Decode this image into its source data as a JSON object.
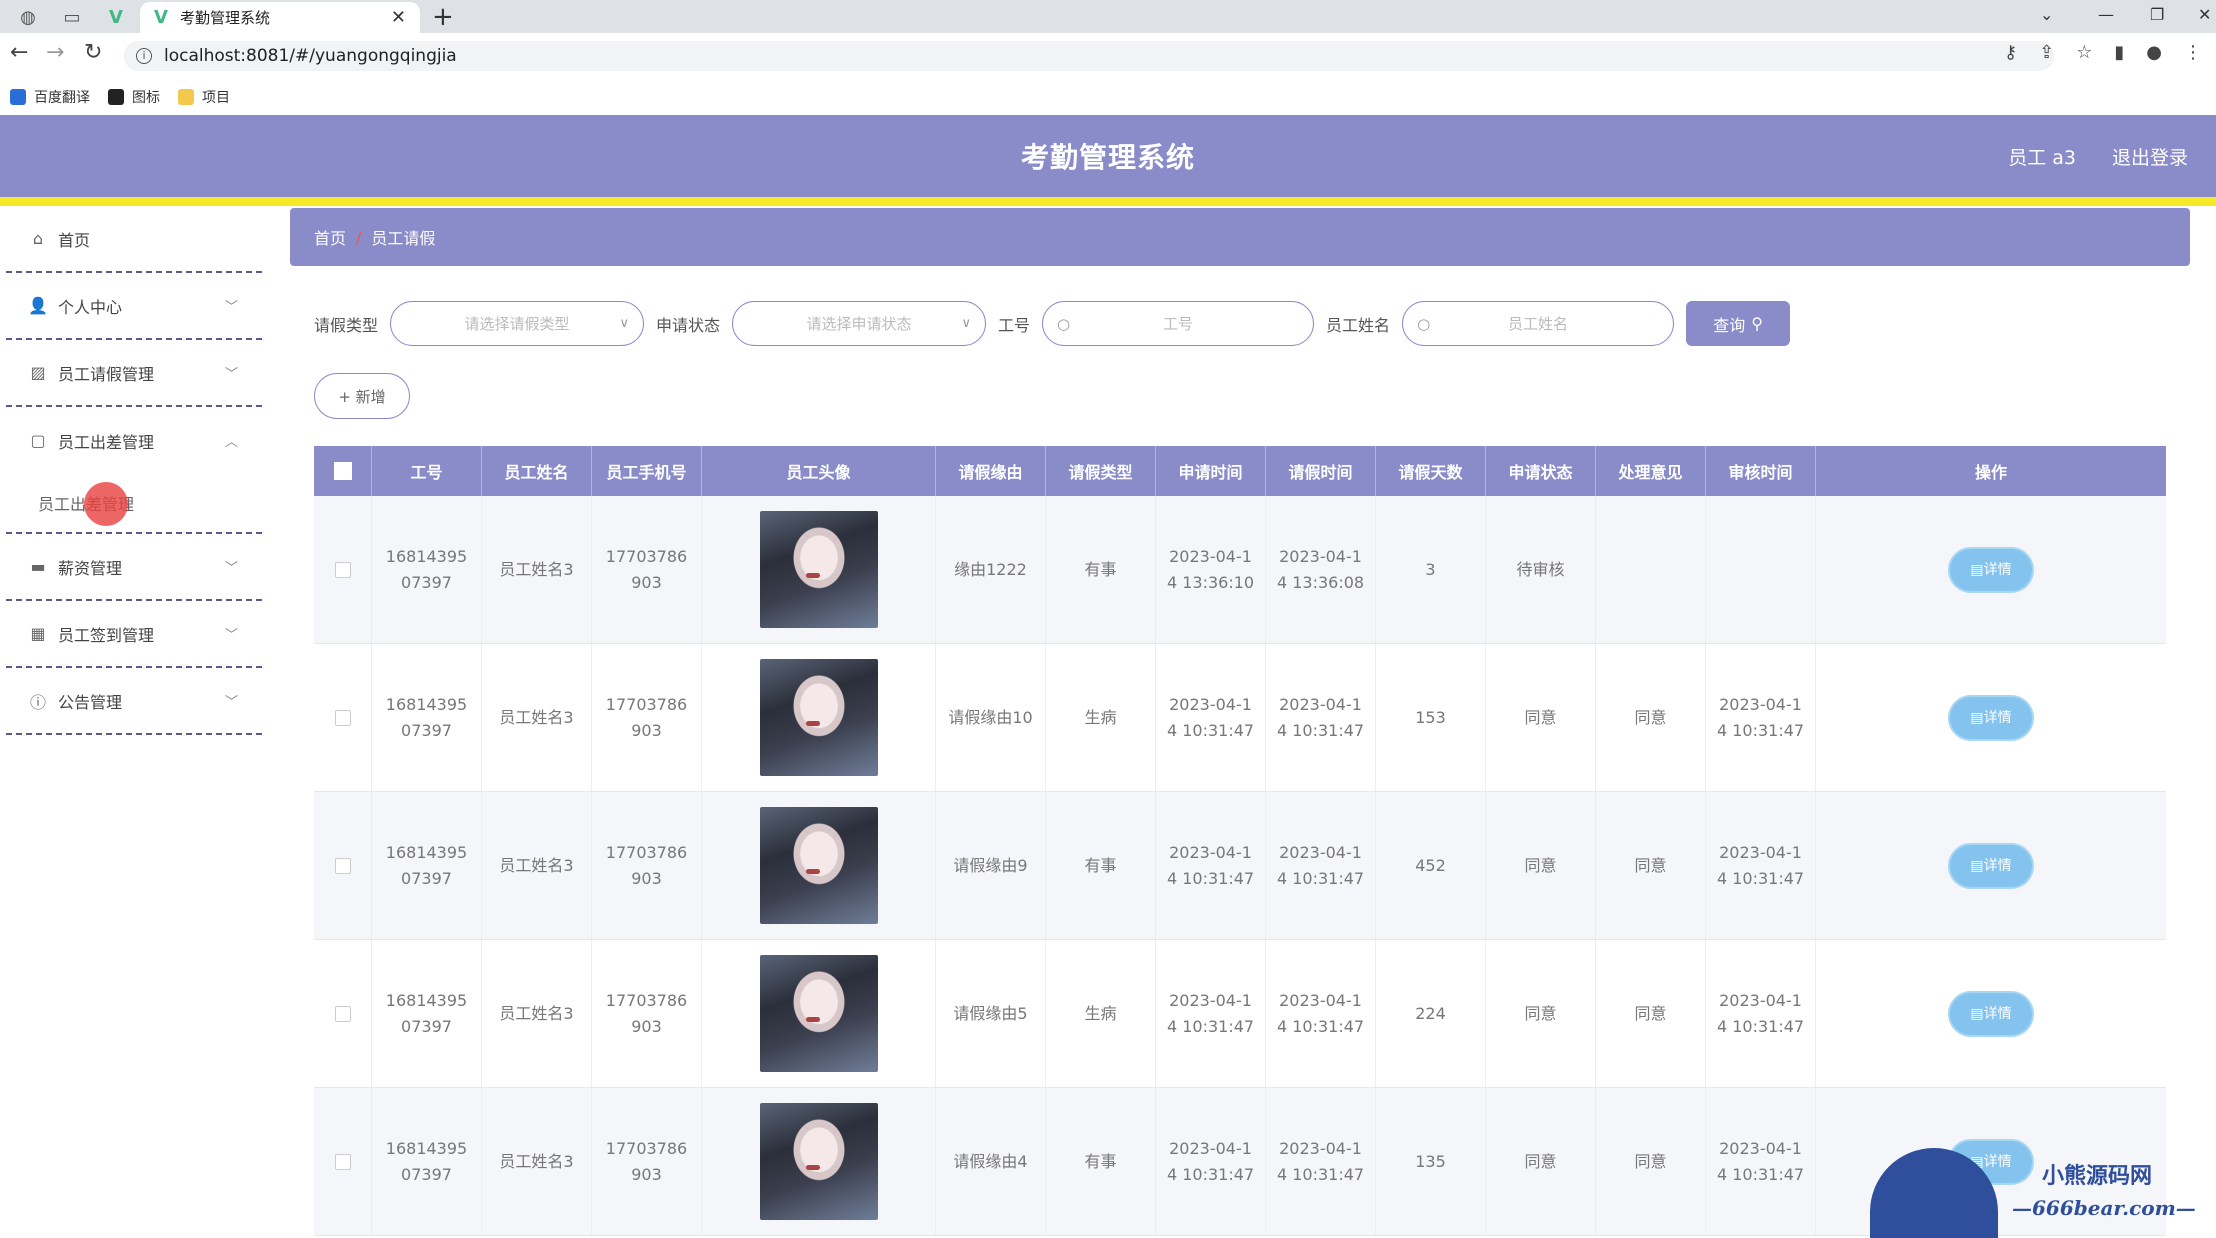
{
  "browser": {
    "tab_title": "考勤管理系统",
    "url": "localhost:8081/#/yuangongqingjia",
    "bookmarks": [
      "百度翻译",
      "图标",
      "项目"
    ]
  },
  "header": {
    "title": "考勤管理系统",
    "user": "员工 a3",
    "logout": "退出登录",
    "bg_color": "#8a8bc9",
    "accent_color": "#f4ea2a"
  },
  "sidebar": {
    "items": [
      {
        "label": "首页",
        "icon": "home-icon"
      },
      {
        "label": "个人中心",
        "icon": "user-icon"
      },
      {
        "label": "员工请假管理",
        "icon": "chart-icon"
      },
      {
        "label": "员工出差管理",
        "icon": "message-icon"
      },
      {
        "label": "薪资管理",
        "icon": "monitor-icon"
      },
      {
        "label": "员工签到管理",
        "icon": "grid-icon"
      },
      {
        "label": "公告管理",
        "icon": "info-icon"
      }
    ],
    "submenu_label": "员工出差管理"
  },
  "breadcrumb": {
    "home": "首页",
    "sep": "/",
    "current": "员工请假"
  },
  "search": {
    "leave_type_label": "请假类型",
    "leave_type_placeholder": "请选择请假类型",
    "status_label": "申请状态",
    "status_placeholder": "请选择申请状态",
    "id_label": "工号",
    "id_placeholder": "工号",
    "name_label": "员工姓名",
    "name_placeholder": "员工姓名",
    "query_button": "查询",
    "add_button": "+ 新增"
  },
  "table": {
    "headers": [
      "工号",
      "员工姓名",
      "员工手机号",
      "员工头像",
      "请假缘由",
      "请假类型",
      "申请时间",
      "请假时间",
      "请假天数",
      "申请状态",
      "处理意见",
      "审核时间",
      "操作"
    ],
    "detail_label": "详情",
    "rows": [
      {
        "id": [
          "16814395",
          "07397"
        ],
        "name": "员工姓名3",
        "phone": [
          "17703786",
          "903"
        ],
        "reason": "缘由1222",
        "type": "有事",
        "apply_time": [
          "2023-04-1",
          "4 13:36:10"
        ],
        "leave_time": [
          "2023-04-1",
          "4 13:36:08"
        ],
        "days": "3",
        "status": "待审核",
        "opinion": "",
        "review_time": [
          "",
          ""
        ]
      },
      {
        "id": [
          "16814395",
          "07397"
        ],
        "name": "员工姓名3",
        "phone": [
          "17703786",
          "903"
        ],
        "reason": "请假缘由10",
        "type": "生病",
        "apply_time": [
          "2023-04-1",
          "4 10:31:47"
        ],
        "leave_time": [
          "2023-04-1",
          "4 10:31:47"
        ],
        "days": "153",
        "status": "同意",
        "opinion": "同意",
        "review_time": [
          "2023-04-1",
          "4 10:31:47"
        ]
      },
      {
        "id": [
          "16814395",
          "07397"
        ],
        "name": "员工姓名3",
        "phone": [
          "17703786",
          "903"
        ],
        "reason": "请假缘由9",
        "type": "有事",
        "apply_time": [
          "2023-04-1",
          "4 10:31:47"
        ],
        "leave_time": [
          "2023-04-1",
          "4 10:31:47"
        ],
        "days": "452",
        "status": "同意",
        "opinion": "同意",
        "review_time": [
          "2023-04-1",
          "4 10:31:47"
        ]
      },
      {
        "id": [
          "16814395",
          "07397"
        ],
        "name": "员工姓名3",
        "phone": [
          "17703786",
          "903"
        ],
        "reason": "请假缘由5",
        "type": "生病",
        "apply_time": [
          "2023-04-1",
          "4 10:31:47"
        ],
        "leave_time": [
          "2023-04-1",
          "4 10:31:47"
        ],
        "days": "224",
        "status": "同意",
        "opinion": "同意",
        "review_time": [
          "2023-04-1",
          "4 10:31:47"
        ]
      },
      {
        "id": [
          "16814395",
          "07397"
        ],
        "name": "员工姓名3",
        "phone": [
          "17703786",
          "903"
        ],
        "reason": "请假缘由4",
        "type": "有事",
        "apply_time": [
          "2023-04-1",
          "4 10:31:47"
        ],
        "leave_time": [
          "2023-04-1",
          "4 10:31:47"
        ],
        "days": "135",
        "status": "同意",
        "opinion": "同意",
        "review_time": [
          "2023-04-1",
          "4 10:31:47"
        ]
      }
    ]
  },
  "watermark": {
    "line1": "小熊源码网",
    "line2": "—666bear.com—"
  }
}
